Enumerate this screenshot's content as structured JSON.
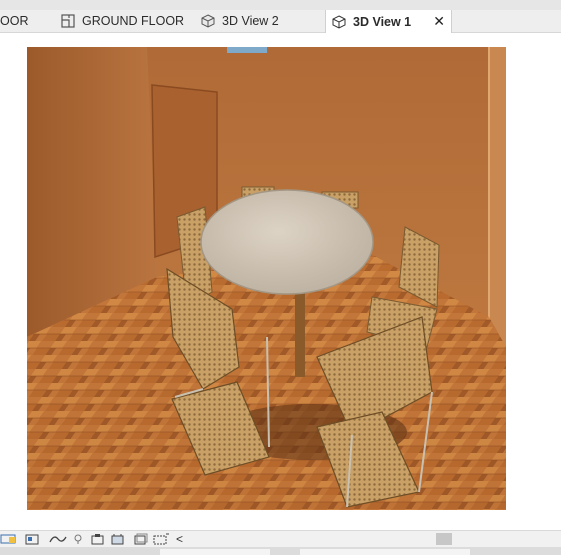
{
  "tabs": [
    {
      "label": "OOR",
      "icon": "floor-plan-icon",
      "active": false
    },
    {
      "label": "GROUND FLOOR",
      "icon": "floor-plan-icon",
      "active": false
    },
    {
      "label": "3D View 2",
      "icon": "3d-view-icon",
      "active": false
    },
    {
      "label": "3D View 1",
      "icon": "3d-view-icon",
      "active": true
    }
  ],
  "close_symbol": "✕",
  "scroll_left_symbol": "<",
  "statusbar_icons": [
    "scale-icon",
    "detail-level-icon",
    "visual-style-icon",
    "sun-path-icon",
    "shadows-icon",
    "crop-view-icon",
    "show-crop-icon",
    "unlock-3d-icon",
    "temporary-hide-icon",
    "reveal-hidden-icon"
  ],
  "render": {
    "scene": "rendered-room-with-round-table-and-chairs",
    "wall_color": "#b06d3a",
    "floor_color": "#b86a2e",
    "table_color": "#d2c7b8"
  }
}
